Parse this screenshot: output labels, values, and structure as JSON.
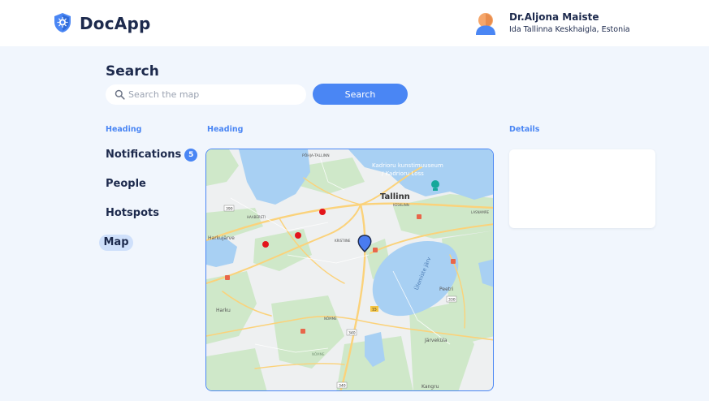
{
  "app": {
    "name": "DocApp"
  },
  "user": {
    "name": "Dr.Aljona Maiste",
    "organization": "Ida Tallinna Keskhaigla, Estonia"
  },
  "search": {
    "title": "Search",
    "placeholder": "Search the map",
    "value": "",
    "button_label": "Search"
  },
  "headings": {
    "nav": "Heading",
    "map": "Heading",
    "details": "Details"
  },
  "nav": {
    "notifications": {
      "label": "Notifications",
      "badge": "5"
    },
    "people": {
      "label": "People"
    },
    "hotspots": {
      "label": "Hotspots"
    },
    "map": {
      "label": "Map"
    }
  },
  "map": {
    "labels": {
      "pohja_tallinn": "PÕHJA-TALLINN",
      "kadriorg_museum": "Kadrioru kunstimuuseum",
      "kadriorg_palace": "/ Kadrioru Loss",
      "tallinn": "Tallinn",
      "kesklinn": "KESKLINN",
      "lasnamae": "LASNAMÄE",
      "haabersti": "HAABERSTI",
      "harkujarve": "Harkujärve",
      "kristiine": "KRISTIINE",
      "ulemiste_jarv": "Ülemiste järv",
      "peetri": "Peetri",
      "harku": "Harku",
      "nomme_upper": "NÕMME",
      "nomme_lower": "NÕMME",
      "jarvekula": "Järveküla",
      "kangru": "Kangru",
      "road_1": "390",
      "road_2": "330",
      "road_3": "340",
      "road_4": "340",
      "road_5": "15"
    }
  },
  "colors": {
    "accent": "#4a86f4",
    "text": "#1d2a4d",
    "background": "#f1f6fd",
    "marker_red": "#e3151b"
  }
}
